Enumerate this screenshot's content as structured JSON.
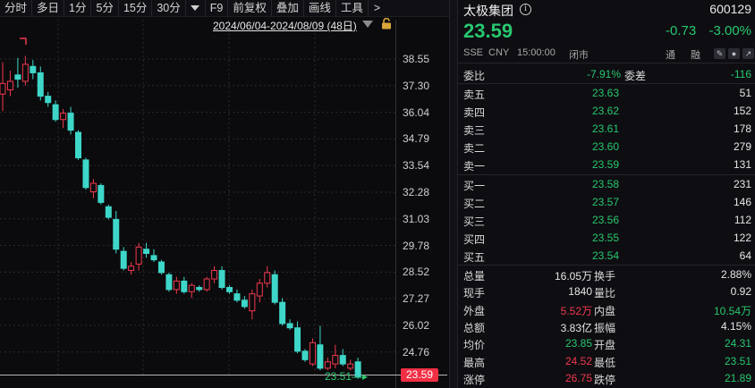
{
  "toolbar": {
    "items": [
      "分时",
      "多日",
      "1分",
      "5分",
      "15分",
      "30分"
    ],
    "dropdown_icon": "triangle-down-icon",
    "items2": [
      "F9",
      "前复权",
      "叠加",
      "画线",
      "工具"
    ],
    "more": ">"
  },
  "chart": {
    "range_label": "2024/06/04-2024/08/09 (48日)",
    "lock_icon": "lock-icon",
    "price_ticks": [
      "38.55",
      "37.30",
      "36.04",
      "34.79",
      "33.54",
      "32.28",
      "31.03",
      "29.78",
      "28.52",
      "27.27",
      "26.02",
      "24.76"
    ],
    "current_price_tag": "23.59",
    "low_marker_label": "23.51",
    "up_color": "#f0394d",
    "down_color": "#3ed6c8",
    "candles": [
      {
        "o": 36.9,
        "h": 38.4,
        "l": 36.1,
        "c": 37.4
      },
      {
        "o": 37.1,
        "h": 38.0,
        "l": 36.8,
        "c": 37.5
      },
      {
        "o": 37.8,
        "h": 38.6,
        "l": 37.2,
        "c": 37.6
      },
      {
        "o": 37.5,
        "h": 38.7,
        "l": 37.3,
        "c": 38.3
      },
      {
        "o": 38.2,
        "h": 38.5,
        "l": 37.6,
        "c": 37.9
      },
      {
        "o": 37.9,
        "h": 38.2,
        "l": 36.6,
        "c": 36.8
      },
      {
        "o": 36.8,
        "h": 37.0,
        "l": 36.3,
        "c": 36.5
      },
      {
        "o": 36.4,
        "h": 36.6,
        "l": 35.6,
        "c": 35.7
      },
      {
        "o": 35.7,
        "h": 36.2,
        "l": 35.3,
        "c": 36.0
      },
      {
        "o": 36.0,
        "h": 36.3,
        "l": 35.0,
        "c": 35.2
      },
      {
        "o": 35.1,
        "h": 35.2,
        "l": 33.8,
        "c": 33.9
      },
      {
        "o": 33.8,
        "h": 33.9,
        "l": 32.4,
        "c": 32.5
      },
      {
        "o": 32.3,
        "h": 32.9,
        "l": 32.0,
        "c": 32.7
      },
      {
        "o": 32.6,
        "h": 32.7,
        "l": 31.7,
        "c": 31.8
      },
      {
        "o": 31.6,
        "h": 31.7,
        "l": 31.0,
        "c": 31.1
      },
      {
        "o": 31.0,
        "h": 31.4,
        "l": 29.4,
        "c": 29.6
      },
      {
        "o": 29.5,
        "h": 29.7,
        "l": 28.6,
        "c": 28.7
      },
      {
        "o": 28.6,
        "h": 29.0,
        "l": 28.4,
        "c": 28.8
      },
      {
        "o": 28.9,
        "h": 29.9,
        "l": 28.6,
        "c": 29.7
      },
      {
        "o": 29.6,
        "h": 29.9,
        "l": 29.2,
        "c": 29.4
      },
      {
        "o": 29.3,
        "h": 29.6,
        "l": 29.0,
        "c": 29.1
      },
      {
        "o": 29.0,
        "h": 29.1,
        "l": 28.4,
        "c": 28.5
      },
      {
        "o": 28.4,
        "h": 28.5,
        "l": 27.6,
        "c": 27.7
      },
      {
        "o": 27.7,
        "h": 28.3,
        "l": 27.5,
        "c": 28.1
      },
      {
        "o": 28.1,
        "h": 28.3,
        "l": 27.5,
        "c": 27.6
      },
      {
        "o": 27.6,
        "h": 28.0,
        "l": 27.3,
        "c": 27.9
      },
      {
        "o": 27.8,
        "h": 27.9,
        "l": 27.6,
        "c": 27.7
      },
      {
        "o": 27.7,
        "h": 28.3,
        "l": 27.6,
        "c": 28.2
      },
      {
        "o": 28.2,
        "h": 28.8,
        "l": 28.0,
        "c": 28.6
      },
      {
        "o": 28.6,
        "h": 28.8,
        "l": 27.7,
        "c": 27.8
      },
      {
        "o": 27.8,
        "h": 27.9,
        "l": 27.5,
        "c": 27.6
      },
      {
        "o": 27.5,
        "h": 27.7,
        "l": 27.1,
        "c": 27.2
      },
      {
        "o": 27.2,
        "h": 27.4,
        "l": 26.8,
        "c": 26.9
      },
      {
        "o": 26.7,
        "h": 27.7,
        "l": 26.3,
        "c": 27.5
      },
      {
        "o": 27.4,
        "h": 28.2,
        "l": 27.1,
        "c": 28.0
      },
      {
        "o": 28.0,
        "h": 28.8,
        "l": 27.8,
        "c": 28.5
      },
      {
        "o": 28.4,
        "h": 28.6,
        "l": 27.0,
        "c": 27.1
      },
      {
        "o": 27.1,
        "h": 27.3,
        "l": 26.0,
        "c": 26.1
      },
      {
        "o": 26.1,
        "h": 26.3,
        "l": 25.8,
        "c": 25.9
      },
      {
        "o": 25.9,
        "h": 26.2,
        "l": 24.7,
        "c": 24.8
      },
      {
        "o": 24.8,
        "h": 24.9,
        "l": 24.3,
        "c": 24.4
      },
      {
        "o": 24.2,
        "h": 25.4,
        "l": 24.1,
        "c": 25.2
      },
      {
        "o": 25.1,
        "h": 26.0,
        "l": 23.9,
        "c": 24.0
      },
      {
        "o": 24.0,
        "h": 24.5,
        "l": 23.9,
        "c": 24.3
      },
      {
        "o": 24.2,
        "h": 25.1,
        "l": 24.0,
        "c": 24.6
      },
      {
        "o": 24.6,
        "h": 24.9,
        "l": 24.1,
        "c": 24.2
      },
      {
        "o": 24.0,
        "h": 24.4,
        "l": 23.9,
        "c": 24.2
      },
      {
        "o": 24.3,
        "h": 24.5,
        "l": 23.5,
        "c": 23.6
      }
    ]
  },
  "quote": {
    "name": "太极集团",
    "info_icon": "info-icon",
    "code": "600129",
    "price": "23.59",
    "change": "-0.73",
    "change_pct": "-3.00%",
    "meta": {
      "exchange": "SSE",
      "currency": "CNY",
      "time": "15:00:00",
      "status": "闭市",
      "link1": "通",
      "link2": "融"
    },
    "meta_icons": [
      "edit-icon",
      "bell-icon",
      "share-icon"
    ],
    "wei": {
      "label1": "委比",
      "value1": "-7.91%",
      "label2": "委差",
      "value2": "-116"
    },
    "asks": [
      {
        "label": "卖五",
        "price": "23.63",
        "vol": "51"
      },
      {
        "label": "卖四",
        "price": "23.62",
        "vol": "152"
      },
      {
        "label": "卖三",
        "price": "23.61",
        "vol": "178"
      },
      {
        "label": "卖二",
        "price": "23.60",
        "vol": "279"
      },
      {
        "label": "卖一",
        "price": "23.59",
        "vol": "131"
      }
    ],
    "bids": [
      {
        "label": "买一",
        "price": "23.58",
        "vol": "231"
      },
      {
        "label": "买二",
        "price": "23.57",
        "vol": "146"
      },
      {
        "label": "买三",
        "price": "23.56",
        "vol": "112"
      },
      {
        "label": "买四",
        "price": "23.55",
        "vol": "122"
      },
      {
        "label": "买五",
        "price": "23.54",
        "vol": "64"
      }
    ],
    "stats": [
      {
        "l1": "总量",
        "v1": "16.05万",
        "c1": "num",
        "l2": "换手",
        "v2": "2.88%",
        "c2": "num"
      },
      {
        "l1": "现手",
        "v1": "1840",
        "c1": "num",
        "l2": "量比",
        "v2": "0.92",
        "c2": "num"
      },
      {
        "l1": "外盘",
        "v1": "5.52万",
        "c1": "r",
        "l2": "内盘",
        "v2": "10.54万",
        "c2": "g"
      },
      {
        "l1": "总额",
        "v1": "3.83亿",
        "c1": "num",
        "l2": "振幅",
        "v2": "4.15%",
        "c2": "num"
      },
      {
        "l1": "均价",
        "v1": "23.85",
        "c1": "g",
        "l2": "开盘",
        "v2": "24.31",
        "c2": "g"
      },
      {
        "l1": "最高",
        "v1": "24.52",
        "c1": "r",
        "l2": "最低",
        "v2": "23.51",
        "c2": "g"
      },
      {
        "l1": "涨停",
        "v1": "26.75",
        "c1": "r",
        "l2": "跌停",
        "v2": "21.89",
        "c2": "g"
      }
    ]
  }
}
